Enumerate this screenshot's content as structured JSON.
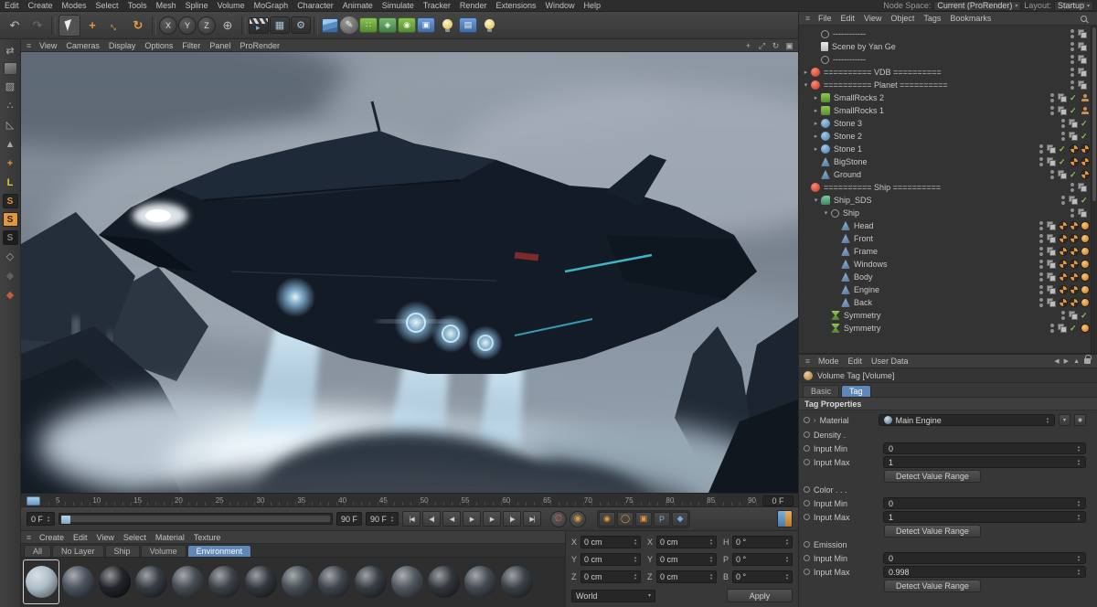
{
  "menubar": {
    "items": [
      "Edit",
      "Create",
      "Modes",
      "Select",
      "Tools",
      "Mesh",
      "Spline",
      "Volume",
      "MoGraph",
      "Character",
      "Animate",
      "Simulate",
      "Tracker",
      "Render",
      "Extensions",
      "Window",
      "Help"
    ],
    "node_space_label": "Node Space:",
    "node_space_value": "Current (ProRender)",
    "layout_label": "Layout:",
    "layout_value": "Startup"
  },
  "toolbar": {
    "icons": [
      {
        "name": "undo-icon",
        "glyph": "↶",
        "cls": "g"
      },
      {
        "name": "redo-icon",
        "glyph": "↷",
        "cls": "dim"
      },
      {
        "name": "toolbar-separator",
        "glyph": "",
        "cls": "sep"
      },
      {
        "name": "live-selection-icon",
        "glyph": "",
        "cls": "sel"
      },
      {
        "name": "move-tool-icon",
        "glyph": "+",
        "cls": "org"
      },
      {
        "name": "scale-tool-icon",
        "glyph": "↔",
        "cls": "org rot45"
      },
      {
        "name": "rotate-tool-icon",
        "glyph": "↻",
        "cls": "org"
      },
      {
        "name": "toolbar-separator",
        "glyph": "",
        "cls": "sep"
      },
      {
        "name": "x-axis-lock-button",
        "glyph": "X",
        "cls": "chip"
      },
      {
        "name": "y-axis-lock-button",
        "glyph": "Y",
        "cls": "chip"
      },
      {
        "name": "z-axis-lock-button",
        "glyph": "Z",
        "cls": "chip"
      },
      {
        "name": "coordinate-system-icon",
        "glyph": "⊕",
        "cls": "g"
      },
      {
        "name": "toolbar-separator",
        "glyph": "",
        "cls": "sep"
      },
      {
        "name": "render-view-icon",
        "glyph": "",
        "cls": "clapper"
      },
      {
        "name": "render-picture-viewer-icon",
        "glyph": "▦",
        "cls": "darkbtn"
      },
      {
        "name": "render-settings-icon",
        "glyph": "⚙",
        "cls": "darkbtn"
      },
      {
        "name": "toolbar-separator",
        "glyph": "",
        "cls": "sep"
      },
      {
        "name": "add-cube-icon",
        "glyph": "",
        "cls": "cube"
      },
      {
        "name": "pen-tool-icon",
        "glyph": "✎",
        "cls": "pen"
      },
      {
        "name": "mograph-icon",
        "glyph": "∷",
        "cls": "grn"
      },
      {
        "name": "simulate-icon",
        "glyph": "◈",
        "cls": "grnb"
      },
      {
        "name": "field-icon",
        "glyph": "◉",
        "cls": "grn"
      },
      {
        "name": "camera-icon",
        "glyph": "▣",
        "cls": "blu"
      },
      {
        "name": "light-icon",
        "glyph": "",
        "cls": "bulb"
      },
      {
        "name": "floor-icon",
        "glyph": "▤",
        "cls": "blu"
      },
      {
        "name": "environment-icon",
        "glyph": "",
        "cls": "bulb"
      }
    ]
  },
  "left_strip": {
    "icons": [
      {
        "name": "make-editable-icon",
        "glyph": "⇄",
        "cls": "g"
      },
      {
        "name": "model-mode-icon",
        "glyph": "",
        "cls": "cubeg"
      },
      {
        "name": "texture-mode-icon",
        "glyph": "▨",
        "cls": "g"
      },
      {
        "name": "points-mode-icon",
        "glyph": "∴",
        "cls": "g"
      },
      {
        "name": "edges-mode-icon",
        "glyph": "◺",
        "cls": "g"
      },
      {
        "name": "polygons-mode-icon",
        "glyph": "▲",
        "cls": "g"
      },
      {
        "name": "tweak-mode-icon",
        "glyph": "+",
        "cls": "org"
      },
      {
        "name": "axis-mode-icon",
        "glyph": "L",
        "cls": "yellow"
      },
      {
        "name": "viewport-solo-off-icon",
        "glyph": "S",
        "cls": "sbadge"
      },
      {
        "name": "viewport-solo-single-icon",
        "glyph": "S",
        "cls": "sbadge on"
      },
      {
        "name": "viewport-solo-hierarchy-icon",
        "glyph": "S",
        "cls": "sbadge off"
      },
      {
        "name": "snap-icon",
        "glyph": "◇",
        "cls": "g"
      },
      {
        "name": "quantize-icon",
        "glyph": "◆",
        "cls": "dark"
      },
      {
        "name": "workplane-icon",
        "glyph": "◆",
        "cls": "red"
      }
    ]
  },
  "viewport": {
    "menu": [
      "View",
      "Cameras",
      "Display",
      "Options",
      "Filter",
      "Panel",
      "ProRender"
    ],
    "nav_icons": [
      {
        "name": "pan-view-icon",
        "glyph": "+"
      },
      {
        "name": "zoom-view-icon",
        "glyph": "⤢"
      },
      {
        "name": "rotate-view-icon",
        "glyph": "↻"
      },
      {
        "name": "toggle-view-icon",
        "glyph": "▣"
      }
    ]
  },
  "timeline": {
    "ticks": [
      "5",
      "10",
      "15",
      "20",
      "25",
      "30",
      "35",
      "40",
      "45",
      "50",
      "55",
      "60",
      "65",
      "70",
      "75",
      "80",
      "85",
      "90"
    ],
    "ruler_end_label": "0 F",
    "current_frame": "0 F",
    "range_end_label": "90 F",
    "end_frame": "90 F",
    "transport": [
      {
        "name": "goto-start-button",
        "glyph": "|◀"
      },
      {
        "name": "prev-key-button",
        "glyph": "◀|"
      },
      {
        "name": "prev-frame-button",
        "glyph": "◀"
      },
      {
        "name": "play-button",
        "glyph": "▶"
      },
      {
        "name": "next-frame-button",
        "glyph": "▶"
      },
      {
        "name": "next-key-button",
        "glyph": "|▶"
      },
      {
        "name": "goto-end-button",
        "glyph": "▶|"
      }
    ],
    "toggles": [
      {
        "name": "mute-sound-button",
        "glyph": "∅",
        "cls": "redfg"
      },
      {
        "name": "solo-animation-button",
        "glyph": "◉",
        "cls": "orgfg"
      }
    ],
    "record_buttons": [
      {
        "name": "record-keyframe-button",
        "glyph": "◉",
        "cls": "orgfg"
      },
      {
        "name": "autokeying-button",
        "glyph": "◯",
        "cls": "orgfg"
      },
      {
        "name": "keyframe-selection-button",
        "glyph": "▣",
        "cls": "orgfg"
      },
      {
        "name": "record-parameter-button",
        "glyph": "P",
        "cls": "blufg"
      },
      {
        "name": "record-pla-button",
        "glyph": "◆",
        "cls": "blufg"
      }
    ]
  },
  "materials": {
    "menu": [
      "Create",
      "Edit",
      "View",
      "Select",
      "Material",
      "Texture"
    ],
    "tabs": [
      {
        "label": "All",
        "cls": ""
      },
      {
        "label": "No Layer",
        "cls": ""
      },
      {
        "label": "Ship",
        "cls": ""
      },
      {
        "label": "Volume",
        "cls": ""
      },
      {
        "label": "Environment",
        "cls": "active"
      }
    ],
    "thumbs": [
      {
        "tone": "#a9bac6",
        "cls": "active"
      },
      {
        "tone": "#3f4854",
        "cls": ""
      },
      {
        "tone": "#14171c",
        "cls": ""
      },
      {
        "tone": "#2a3038",
        "cls": ""
      },
      {
        "tone": "#3a4148",
        "cls": ""
      },
      {
        "tone": "#30363d",
        "cls": ""
      },
      {
        "tone": "#272c33",
        "cls": ""
      },
      {
        "tone": "#3d444c",
        "cls": ""
      },
      {
        "tone": "#333a42",
        "cls": ""
      },
      {
        "tone": "#2b3138",
        "cls": ""
      },
      {
        "tone": "#454c55",
        "cls": ""
      },
      {
        "tone": "#262b31",
        "cls": ""
      },
      {
        "tone": "#383f47",
        "cls": ""
      },
      {
        "tone": "#2f353c",
        "cls": ""
      }
    ]
  },
  "coords": {
    "cells": [
      {
        "label": "X",
        "value": "0 cm"
      },
      {
        "label": "Y",
        "value": "0 cm"
      },
      {
        "label": "Z",
        "value": "0 cm"
      },
      {
        "label": "X",
        "value": "0 cm"
      },
      {
        "label": "Y",
        "value": "0 cm"
      },
      {
        "label": "Z",
        "value": "0 cm"
      },
      {
        "label": "H",
        "value": "0 °"
      },
      {
        "label": "P",
        "value": "0 °"
      },
      {
        "label": "B",
        "value": "0 °"
      }
    ],
    "space_value": "World",
    "apply_label": "Apply"
  },
  "object_manager": {
    "menu": [
      "File",
      "Edit",
      "View",
      "Object",
      "Tags",
      "Bookmarks"
    ],
    "rows": [
      {
        "label": "------------",
        "lv": "lv1",
        "icon": "ic-null",
        "tags": []
      },
      {
        "label": "Scene by Yan Ge",
        "lv": "lv1",
        "icon": "ic-note",
        "tags": []
      },
      {
        "label": "------------",
        "lv": "lv1",
        "icon": "ic-null",
        "tags": []
      },
      {
        "label": "========== VDB ==========",
        "lv": "lv0",
        "icon": "ic-alert",
        "exp": "▸",
        "tags": []
      },
      {
        "label": "========== Planet ==========",
        "lv": "lv0",
        "icon": "ic-alert",
        "exp": "▾",
        "tags": []
      },
      {
        "label": "SmallRocks 2",
        "lv": "lv1",
        "icon": "ic-cloner",
        "exp": "▸",
        "tags": [
          "chk",
          "person"
        ]
      },
      {
        "label": "SmallRocks 1",
        "lv": "lv1",
        "icon": "ic-cloner",
        "exp": "▸",
        "tags": [
          "chk",
          "person"
        ]
      },
      {
        "label": "Stone 3",
        "lv": "lv1",
        "icon": "ic-sphere",
        "exp": "▸",
        "tags": [
          "chk"
        ]
      },
      {
        "label": "Stone 2",
        "lv": "lv1",
        "icon": "ic-sphere",
        "exp": "▸",
        "tags": [
          "chk"
        ]
      },
      {
        "label": "Stone 1",
        "lv": "lv1",
        "icon": "ic-sphere",
        "exp": "▸",
        "tags": [
          "chk",
          "ball",
          "ball"
        ]
      },
      {
        "label": "BigStone",
        "lv": "lv1",
        "icon": "ic-poly",
        "tags": [
          "chk",
          "ball",
          "ball"
        ]
      },
      {
        "label": "Ground",
        "lv": "lv1",
        "icon": "ic-poly",
        "tags": [
          "chk",
          "ball"
        ]
      },
      {
        "label": "========== Ship ==========",
        "lv": "lv0",
        "icon": "ic-alert",
        "tags": []
      },
      {
        "label": "Ship_SDS",
        "lv": "lv1",
        "icon": "ic-sds",
        "exp": "▾",
        "tags": [
          "chk"
        ]
      },
      {
        "label": "Ship",
        "lv": "lv2",
        "icon": "ic-null",
        "exp": "▾",
        "tags": []
      },
      {
        "label": "Head",
        "lv": "lv3",
        "icon": "ic-poly",
        "tags": [
          "ball",
          "ball",
          "orn"
        ]
      },
      {
        "label": "Front",
        "lv": "lv3",
        "icon": "ic-poly",
        "tags": [
          "ball",
          "ball",
          "orn"
        ]
      },
      {
        "label": "Frame",
        "lv": "lv3",
        "icon": "ic-poly",
        "tags": [
          "ball",
          "ball",
          "orn"
        ]
      },
      {
        "label": "Windows",
        "lv": "lv3",
        "icon": "ic-poly",
        "tags": [
          "ball",
          "ball",
          "orn"
        ]
      },
      {
        "label": "Body",
        "lv": "lv3",
        "icon": "ic-poly",
        "tags": [
          "ball",
          "ball",
          "orn"
        ]
      },
      {
        "label": "Engine",
        "lv": "lv3",
        "icon": "ic-poly",
        "tags": [
          "ball",
          "ball",
          "orn"
        ]
      },
      {
        "label": "Back",
        "lv": "lv3",
        "icon": "ic-poly",
        "tags": [
          "ball",
          "ball",
          "orn"
        ]
      },
      {
        "label": "Symmetry",
        "lv": "lv2",
        "icon": "ic-sym",
        "tags": [
          "chk"
        ]
      },
      {
        "label": "Symmetry",
        "lv": "lv2",
        "icon": "ic-sym",
        "tags": [
          "chk",
          "orn"
        ]
      }
    ]
  },
  "attributes": {
    "menu": [
      "Mode",
      "Edit",
      "User Data"
    ],
    "title": "Volume Tag [Volume]",
    "tabs": [
      {
        "label": "Basic",
        "cls": ""
      },
      {
        "label": "Tag",
        "cls": "active"
      }
    ],
    "section_title": "Tag Properties",
    "material_label": "Material",
    "material_value": "Main Engine",
    "min_label": "Input Min",
    "max_label": "Input Max",
    "groups": [
      {
        "label": "Density .",
        "min": "0",
        "max": "1",
        "button": "Detect Value Range"
      },
      {
        "label": "Color . . .",
        "min": "0",
        "max": "1",
        "button": "Detect Value Range"
      },
      {
        "label": "Emission",
        "min": "0",
        "max": "0.998",
        "button": "Detect Value Range"
      }
    ]
  }
}
